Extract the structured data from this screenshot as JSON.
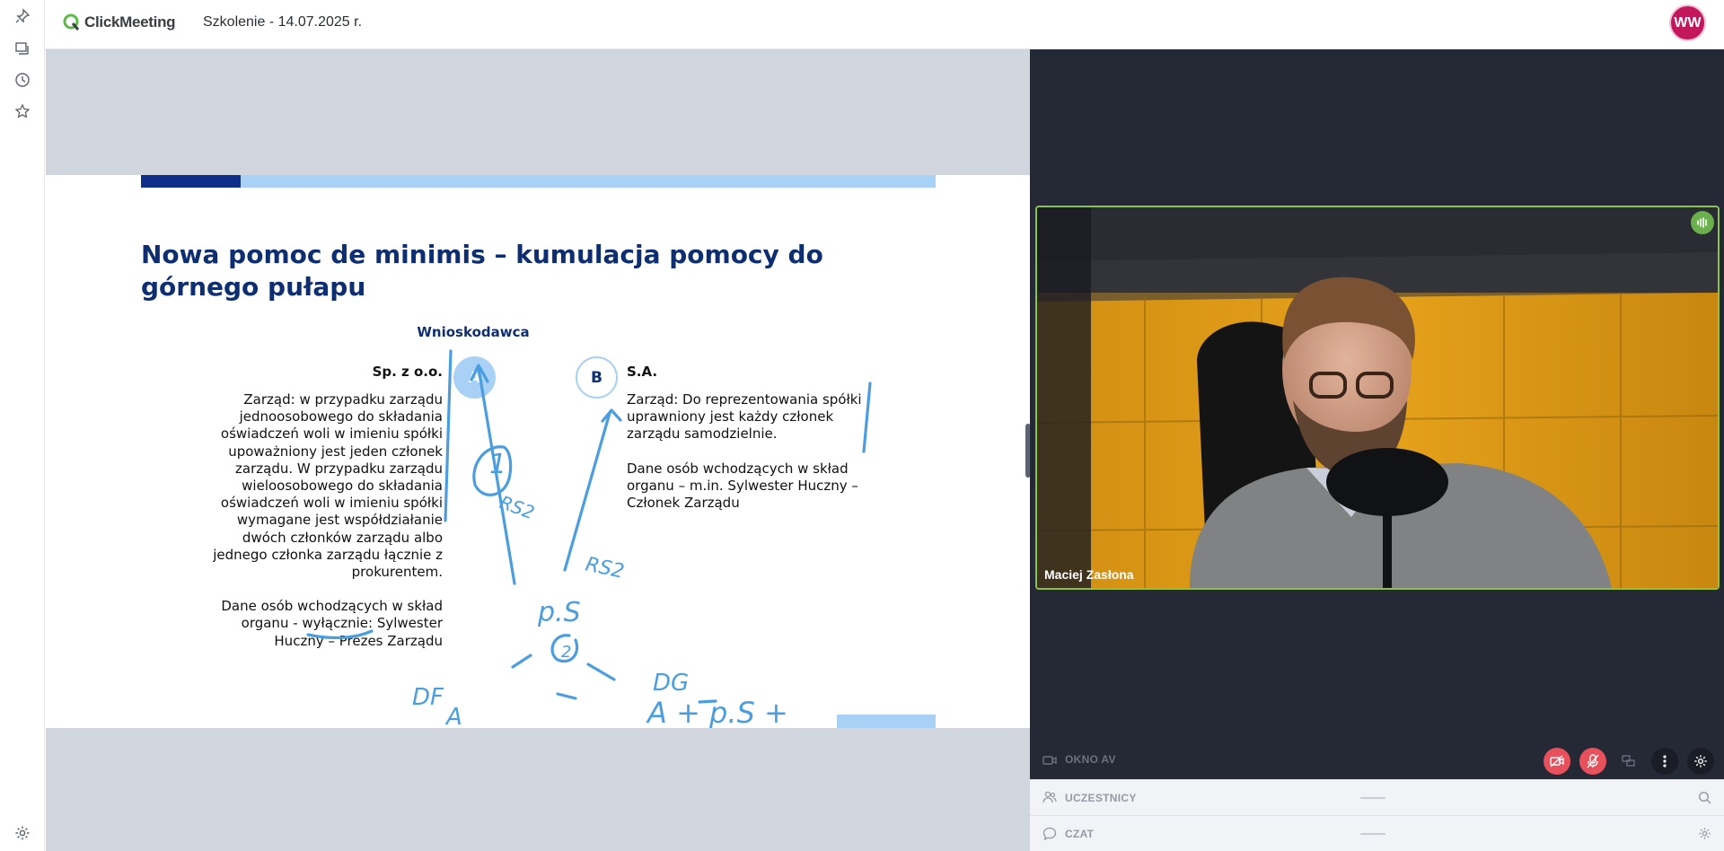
{
  "app": {
    "brand": "ClickMeeting",
    "meeting_title": "Szkolenie - 14.07.2025 r.",
    "user_initials": "WW"
  },
  "rail": {
    "icons": [
      "pin-icon",
      "presentation-icon",
      "history-icon",
      "star-icon",
      "settings-icon"
    ]
  },
  "slide": {
    "title": "Nowa pomoc de minimis – kumulacja pomocy do górnego pułapu",
    "header": "Wnioskodawca",
    "company_a": {
      "circle": "A",
      "label": "Sp. z o.o.",
      "p1": "Zarząd: w przypadku zarządu jednoosobowego do składania oświadczeń woli w imieniu spółki upoważniony jest jeden członek zarządu. W przypadku zarządu wieloosobowego do składania oświadczeń woli w imieniu spółki wymagane jest współdziałanie dwóch członków zarządu albo jednego członka zarządu łącznie z prokurentem.",
      "p2": "Dane osób wchodzących w skład organu - wyłącznie: Sylwester Huczny – Prezes Zarządu"
    },
    "company_b": {
      "circle": "B",
      "label": "S.A.",
      "p1": "Zarząd: Do reprezentowania spółki uprawniony jest każdy członek zarządu samodzielnie.",
      "p2": "Dane osób wchodzących w skład organu – m.in. Sylwester Huczny – Członek Zarządu"
    },
    "handwriting": [
      "1",
      "RS2",
      "RS2",
      "p.S",
      "2",
      "DF",
      "A",
      "DG",
      "A + p.S +"
    ]
  },
  "video": {
    "participant_name": "Maciej Zasłona"
  },
  "av_window": {
    "label": "OKNO AV"
  },
  "panels": {
    "participants_label": "UCZESTNICY",
    "chat_label": "CZAT"
  },
  "colors": {
    "accent_green": "#8bc34a",
    "slide_navy": "#0e2e72",
    "slide_light_blue": "#a9d0f5",
    "control_red": "#e8505b",
    "avatar": "#c2185b"
  }
}
